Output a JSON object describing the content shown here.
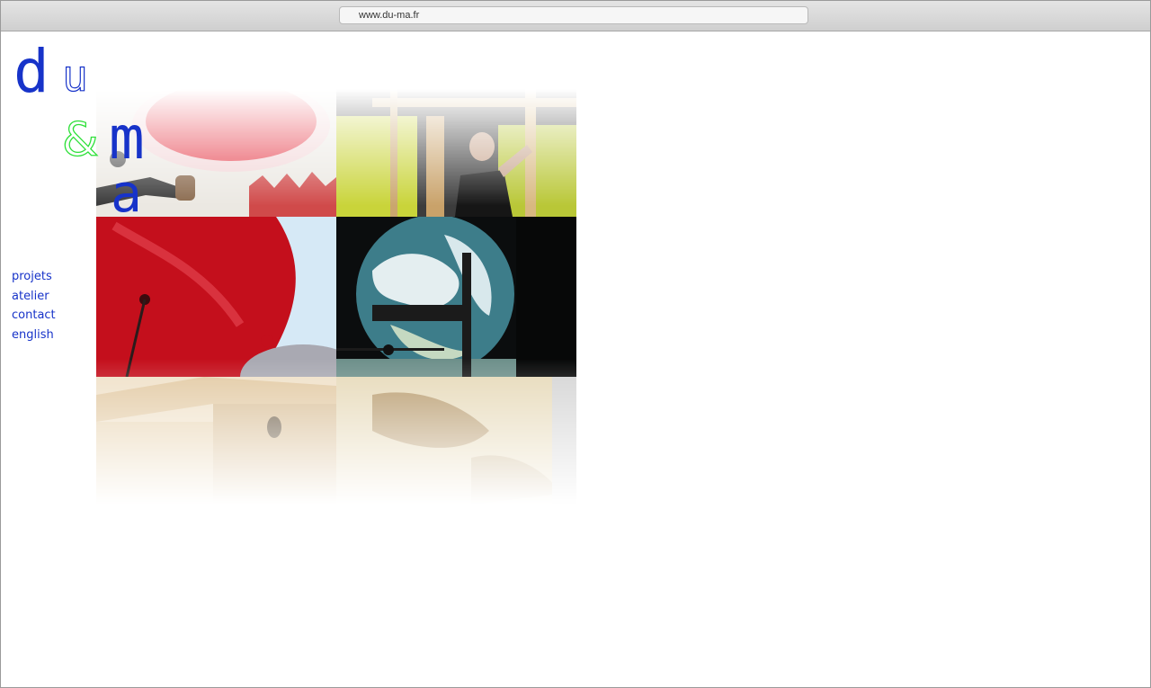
{
  "browser": {
    "url": "www.du-ma.fr"
  },
  "logo": {
    "d": "d",
    "u": "u",
    "amp": "&",
    "m": "m",
    "a": "a",
    "colors": {
      "primary": "#1733c9",
      "accent": "#2fe03a"
    }
  },
  "nav": {
    "items": [
      {
        "label": "projets"
      },
      {
        "label": "atelier"
      },
      {
        "label": "contact"
      },
      {
        "label": "english"
      }
    ]
  },
  "mosaic": {
    "tiles": [
      {
        "name": "red-white-installation"
      },
      {
        "name": "man-on-scaffold"
      },
      {
        "name": "red-hull-sculpture"
      },
      {
        "name": "earth-projection"
      },
      {
        "name": "wooden-structure"
      },
      {
        "name": "map-surface"
      }
    ]
  }
}
